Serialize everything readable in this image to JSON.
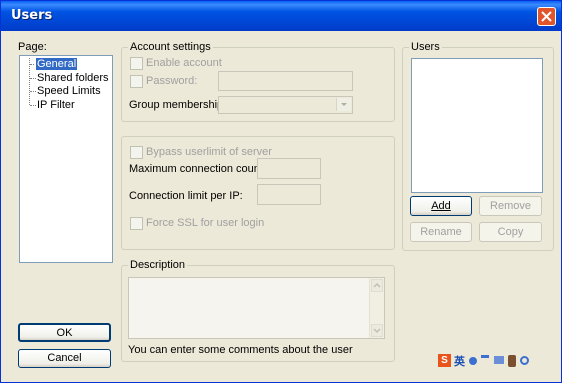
{
  "window": {
    "title": "Users"
  },
  "page_panel": {
    "label": "Page:",
    "items": [
      {
        "label": "General",
        "selected": true
      },
      {
        "label": "Shared folders",
        "selected": false
      },
      {
        "label": "Speed Limits",
        "selected": false
      },
      {
        "label": "IP Filter",
        "selected": false
      }
    ]
  },
  "account_settings": {
    "title": "Account settings",
    "enable_account": "Enable account",
    "password": "Password:",
    "group_membership": "Group membership:"
  },
  "limits": {
    "bypass_userlimit": "Bypass userlimit of server",
    "max_connection_count": "Maximum connection count:",
    "connection_limit_per_ip": "Connection limit per IP:",
    "force_ssl": "Force SSL for user login"
  },
  "description": {
    "title": "Description",
    "hint": "You can enter some comments about the user"
  },
  "users": {
    "title": "Users",
    "add": "Add",
    "remove": "Remove",
    "rename": "Rename",
    "copy": "Copy"
  },
  "buttons": {
    "ok": "OK",
    "cancel": "Cancel"
  },
  "tray": {
    "ime_char": "英"
  }
}
